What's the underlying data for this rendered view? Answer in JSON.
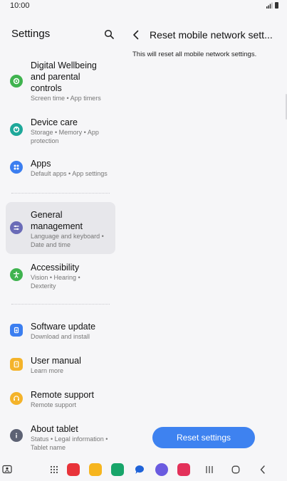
{
  "status_bar": {
    "time": "10:00"
  },
  "left_pane": {
    "title": "Settings",
    "items": [
      {
        "title_line1": "Digital Wellbeing",
        "title_line2": "and parental",
        "title_line3": "controls",
        "subtitle": "Screen time  •  App timers",
        "icon": "digital-wellbeing-icon",
        "color": "#3fb34f"
      },
      {
        "title": "Device care",
        "subtitle_line1": "Storage  •  Memory  •  App",
        "subtitle_line2": "protection",
        "icon": "device-care-icon",
        "color": "#1ea89a"
      },
      {
        "title": "Apps",
        "subtitle": "Default apps  •  App settings",
        "icon": "apps-icon",
        "color": "#3b7ef0"
      },
      {
        "title_line1": "General",
        "title_line2": "management",
        "subtitle_line1": "Language and keyboard  •",
        "subtitle_line2": "Date and time",
        "icon": "general-management-icon",
        "color": "#6a6bb7",
        "selected": true
      },
      {
        "title": "Accessibility",
        "subtitle_line1": "Vision  •  Hearing  •",
        "subtitle_line2": "Dexterity",
        "icon": "accessibility-icon",
        "color": "#3fb34f"
      },
      {
        "title": "Software update",
        "subtitle": "Download and install",
        "icon": "software-update-icon",
        "color": "#3b7ef0"
      },
      {
        "title": "User manual",
        "subtitle": "Learn more",
        "icon": "user-manual-icon",
        "color": "#f4b32a"
      },
      {
        "title": "Remote support",
        "subtitle": "Remote support",
        "icon": "remote-support-icon",
        "color": "#f4b32a"
      },
      {
        "title": "About tablet",
        "subtitle_line1": "Status  •  Legal information  •",
        "subtitle_line2": "Tablet name",
        "icon": "about-tablet-icon",
        "color": "#5d6274"
      }
    ]
  },
  "right_pane": {
    "title": "Reset mobile network sett...",
    "description": "This will reset all mobile network settings.",
    "button_label": "Reset settings"
  },
  "colors": {
    "accent": "#3e82f0",
    "background": "#f6f6f8",
    "selected": "#e7e7eb"
  }
}
